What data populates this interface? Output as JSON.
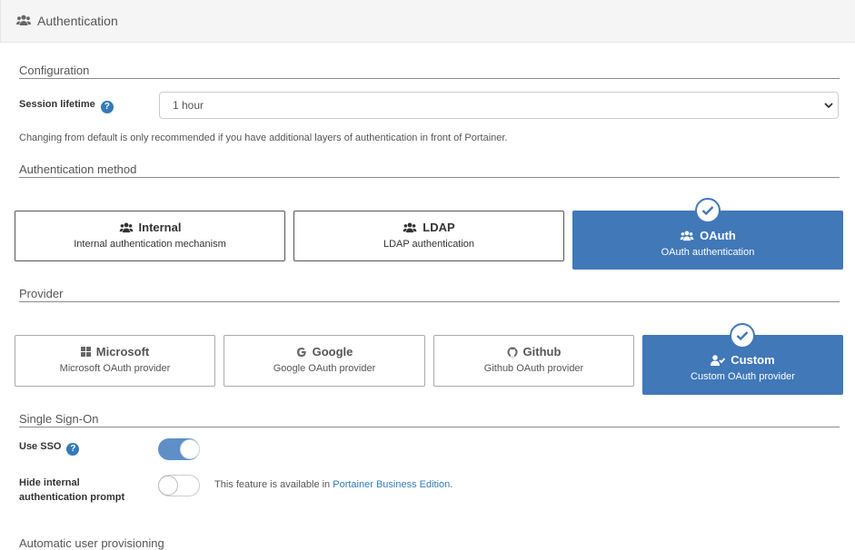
{
  "header": {
    "title": "Authentication",
    "icon": "users-icon"
  },
  "configuration": {
    "title": "Configuration",
    "session_label": "Session lifetime",
    "session_value": "1 hour",
    "hint": "Changing from default is only recommended if you have additional layers of authentication in front of Portainer."
  },
  "auth_method": {
    "title": "Authentication method",
    "options": [
      {
        "title": "Internal",
        "subtitle": "Internal authentication mechanism",
        "icon": "users-icon",
        "selected": false
      },
      {
        "title": "LDAP",
        "subtitle": "LDAP authentication",
        "icon": "users-icon",
        "selected": false
      },
      {
        "title": "OAuth",
        "subtitle": "OAuth authentication",
        "icon": "users-icon",
        "selected": true
      }
    ]
  },
  "provider": {
    "title": "Provider",
    "options": [
      {
        "title": "Microsoft",
        "subtitle": "Microsoft OAuth provider",
        "icon": "windows-icon",
        "selected": false
      },
      {
        "title": "Google",
        "subtitle": "Google OAuth provider",
        "icon": "google-icon",
        "selected": false
      },
      {
        "title": "Github",
        "subtitle": "Github OAuth provider",
        "icon": "github-icon",
        "selected": false
      },
      {
        "title": "Custom",
        "subtitle": "Custom OAuth provider",
        "icon": "user-check-icon",
        "selected": true
      }
    ]
  },
  "sso": {
    "title": "Single Sign-On",
    "use_sso_label": "Use SSO",
    "use_sso_on": true,
    "hide_prompt_label": "Hide internal authentication prompt",
    "hide_prompt_on": false,
    "feature_text": "This feature is available in",
    "feature_link": "Portainer Business Edition",
    "feature_suffix": "."
  },
  "provisioning": {
    "title": "Automatic user provisioning"
  },
  "colors": {
    "accent": "#4078b8",
    "link": "#337ab7"
  }
}
